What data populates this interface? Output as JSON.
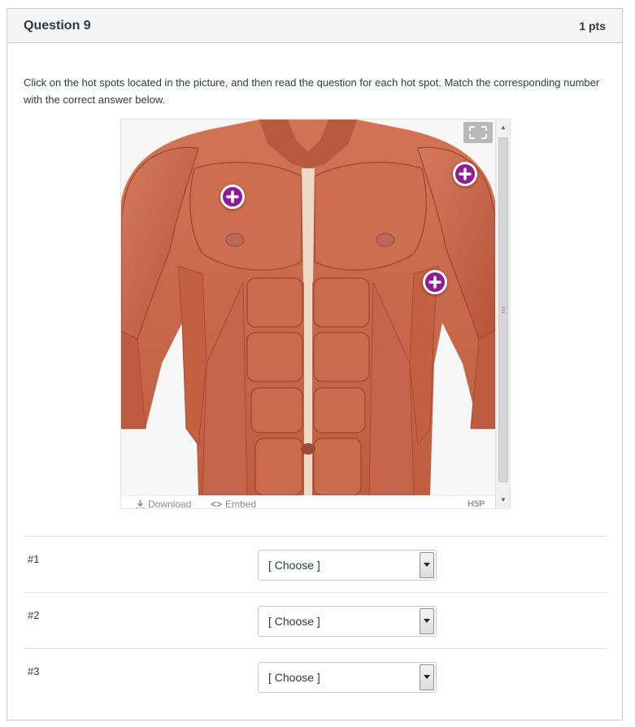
{
  "question": {
    "title": "Question 9",
    "points": "1 pts",
    "text": "Click on the hot spots located in the picture, and then read the question for each hot spot. Match the corresponding number with the correct answer below."
  },
  "h5p": {
    "footer": {
      "download_label": "Download",
      "embed_label": "Embed",
      "brand": "H5P"
    },
    "hotspots": [
      {
        "name": "hotspot-1",
        "icon": "plus-icon"
      },
      {
        "name": "hotspot-2",
        "icon": "plus-icon"
      },
      {
        "name": "hotspot-3",
        "icon": "plus-icon"
      }
    ],
    "colors": {
      "hotspot": "#8e1c97",
      "muscle": "#c8664a",
      "background": "#f7f7f7"
    }
  },
  "answers": [
    {
      "label": "#1",
      "selected": "[ Choose ]"
    },
    {
      "label": "#2",
      "selected": "[ Choose ]"
    },
    {
      "label": "#3",
      "selected": "[ Choose ]"
    }
  ]
}
